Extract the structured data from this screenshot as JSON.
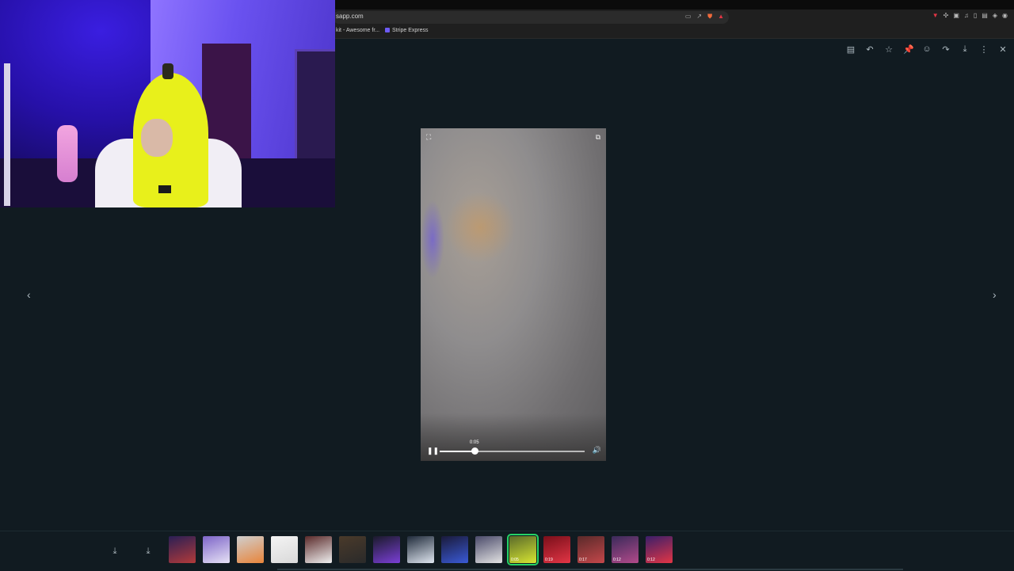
{
  "browser": {
    "url": "sapp.com",
    "bookmarks": [
      {
        "label": "kit - Awesome fr..."
      },
      {
        "label": "Stripe Express"
      }
    ]
  },
  "viewer": {
    "toolbar_icons": [
      "message-icon",
      "reply-icon",
      "star-icon",
      "pin-icon",
      "emoji-icon",
      "forward-icon",
      "download-icon",
      "more-icon",
      "close-icon"
    ],
    "prev_glyph": "‹",
    "next_glyph": "›"
  },
  "video": {
    "time_label": "0:05",
    "progress": 0.24,
    "expand_glyph": "⛶",
    "popout_glyph": "⧉",
    "pause_glyph": "❚❚",
    "volume_glyph": "🔊"
  },
  "strip": {
    "download_glyph": "⤓",
    "thumbnails": [
      {
        "colors": [
          "#2a1f55",
          "#b23a3a"
        ],
        "duration": ""
      },
      {
        "colors": [
          "#7d65c8",
          "#e7e2f5"
        ],
        "duration": ""
      },
      {
        "colors": [
          "#cfcfcf",
          "#e8843a"
        ],
        "duration": ""
      },
      {
        "colors": [
          "#f4f4f4",
          "#d9d9d9"
        ],
        "duration": ""
      },
      {
        "colors": [
          "#5a2a2a",
          "#f0f0f0"
        ],
        "duration": ""
      },
      {
        "colors": [
          "#4a3a2a",
          "#2a2a2a"
        ],
        "duration": ""
      },
      {
        "colors": [
          "#1a1a2a",
          "#7b3fd6"
        ],
        "duration": ""
      },
      {
        "colors": [
          "#1f2a3a",
          "#dfe6f0"
        ],
        "duration": ""
      },
      {
        "colors": [
          "#1a1a3a",
          "#3a5ad6"
        ],
        "duration": ""
      },
      {
        "colors": [
          "#4a4a6a",
          "#e3e3e3"
        ],
        "duration": ""
      },
      {
        "colors": [
          "#5a6a2a",
          "#d8e632"
        ],
        "duration": "0:05",
        "selected": true
      },
      {
        "colors": [
          "#7a0f1a",
          "#e23545"
        ],
        "duration": "0:19"
      },
      {
        "colors": [
          "#5a2a2a",
          "#c4474a"
        ],
        "duration": "0:17"
      },
      {
        "colors": [
          "#3a2a5a",
          "#b24a8a"
        ],
        "duration": "0:12"
      },
      {
        "colors": [
          "#3a1f6a",
          "#e23545"
        ],
        "duration": "0:12"
      }
    ]
  }
}
